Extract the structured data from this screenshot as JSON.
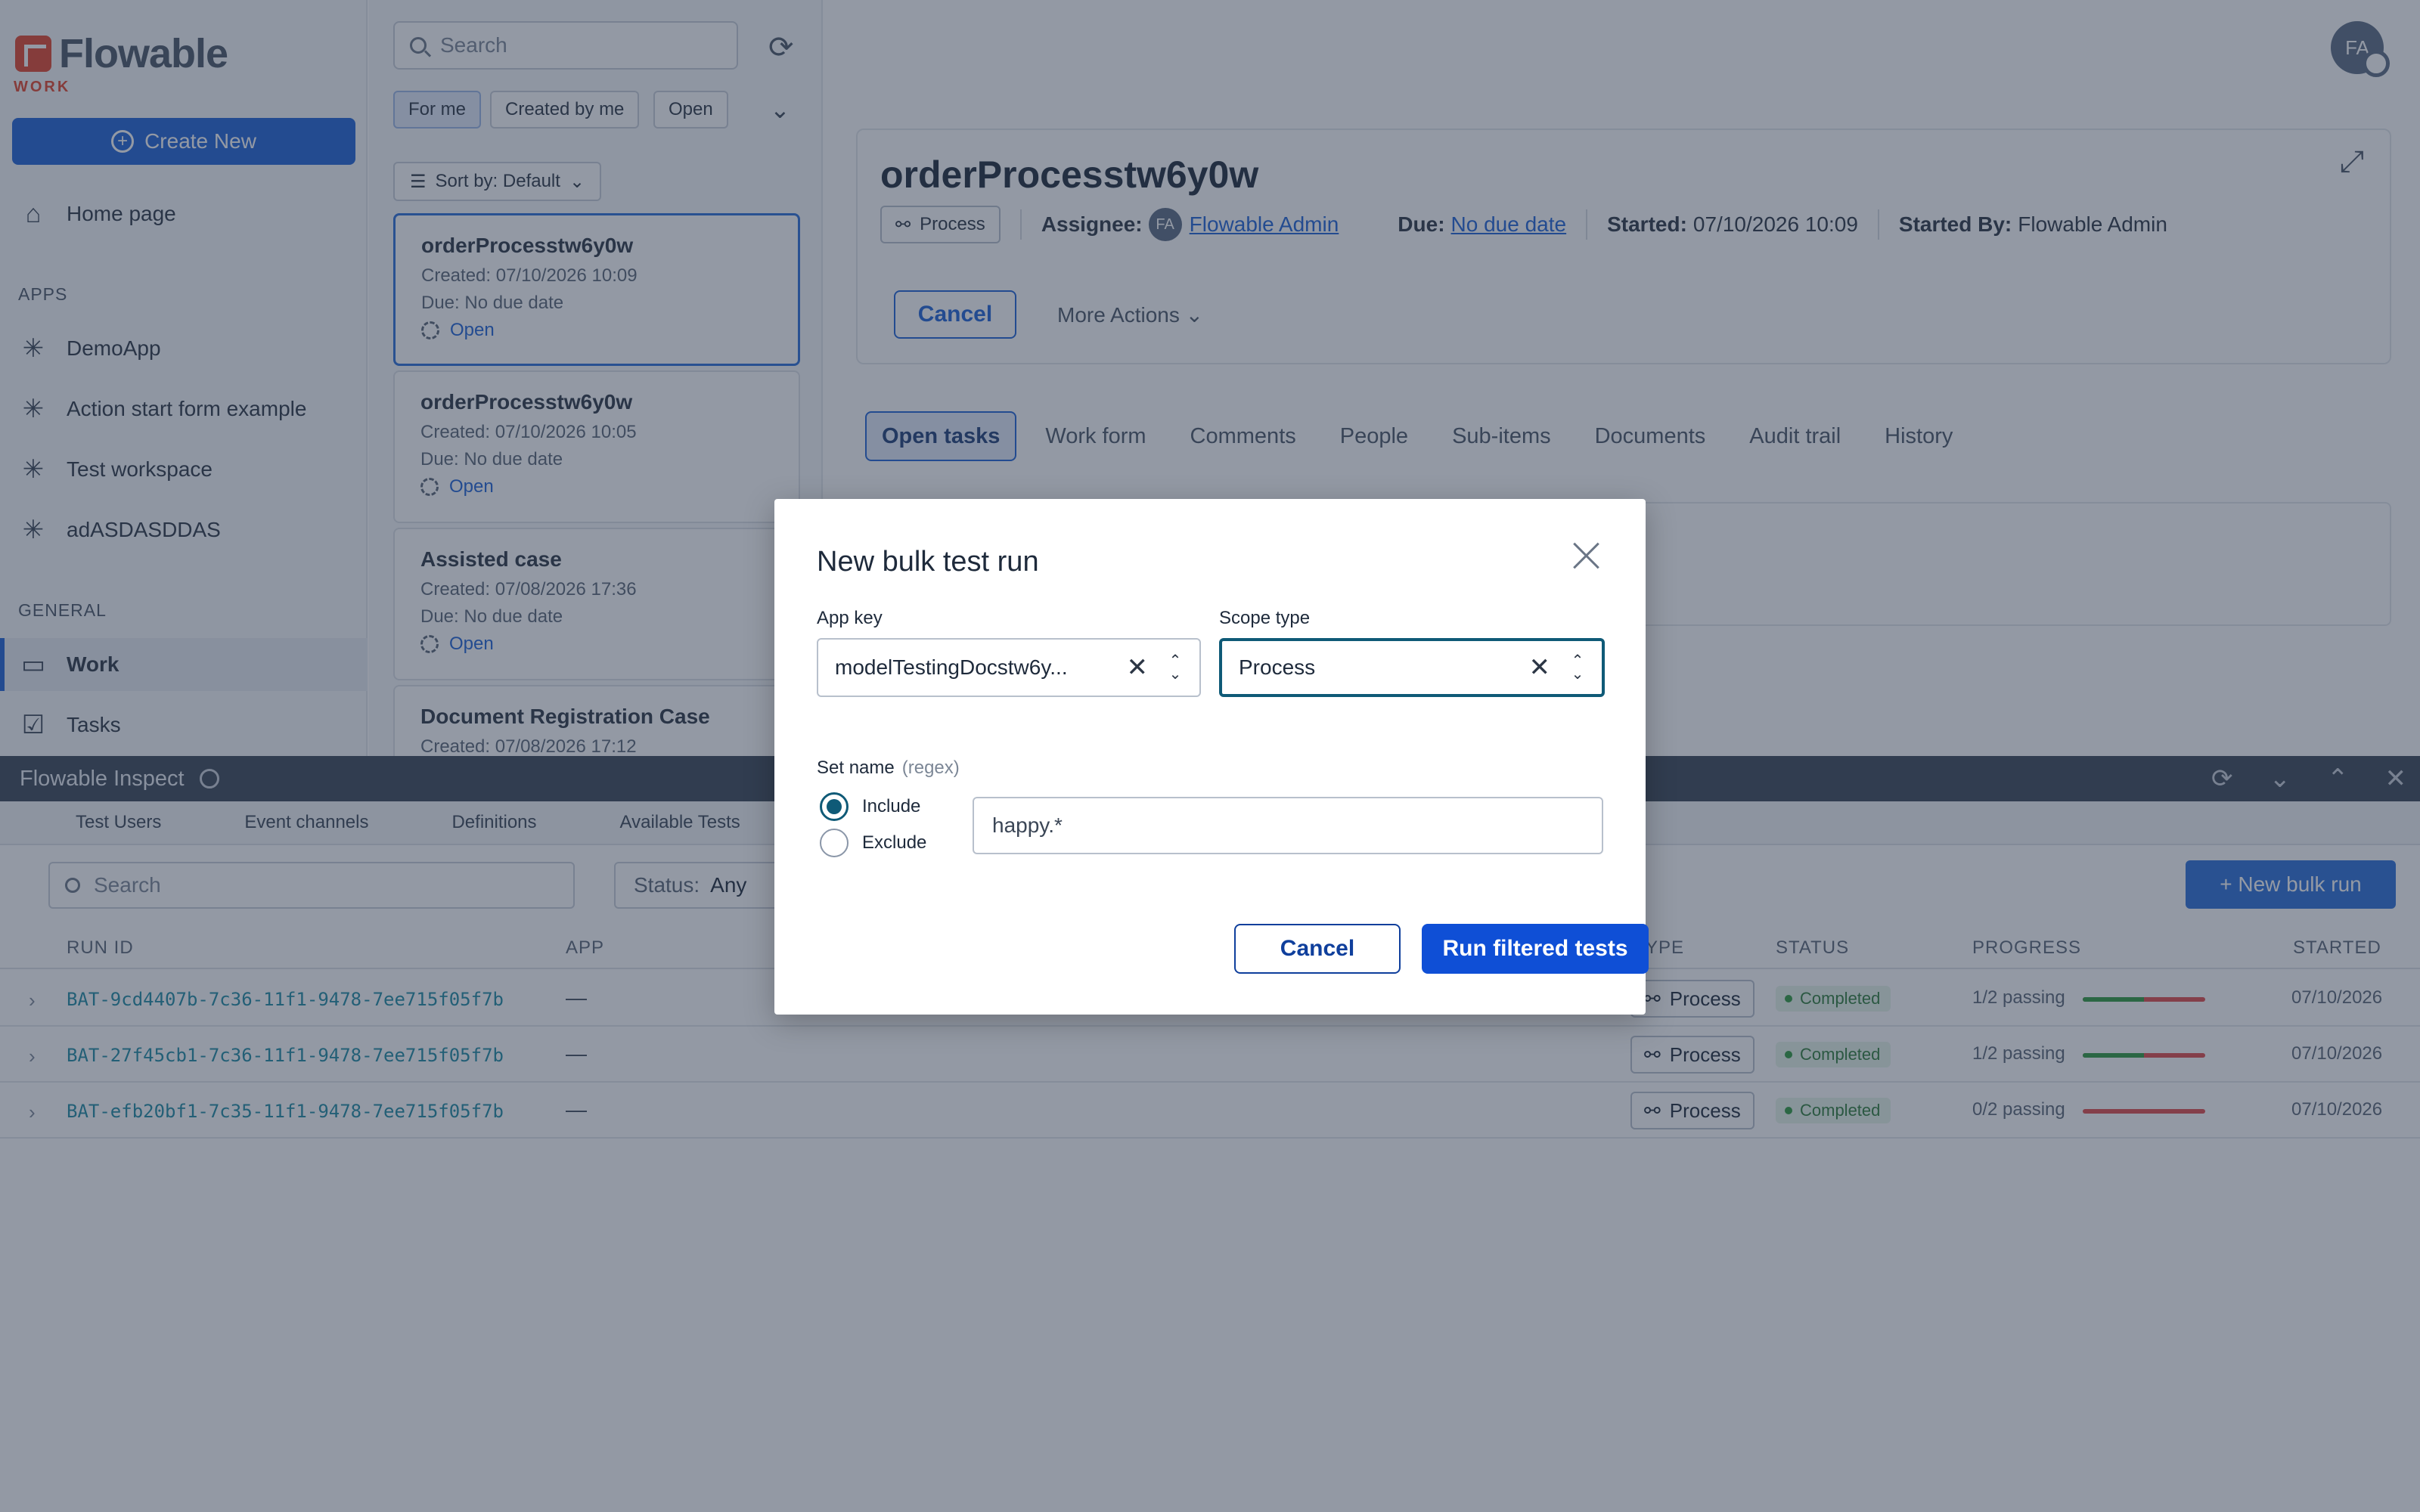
{
  "app": {
    "logo_text": "Flowable",
    "logo_sub": "WORK",
    "create_new": "Create New"
  },
  "sidebar": {
    "home": "Home page",
    "apps_heading": "APPS",
    "apps": [
      "DemoApp",
      "Action start form example",
      "Test workspace",
      "adASDASDDAS"
    ],
    "general_heading": "GENERAL",
    "general": [
      "Work",
      "Tasks"
    ]
  },
  "list": {
    "search_placeholder": "Search",
    "filters": [
      "For me",
      "Created by me",
      "Open"
    ],
    "sort_label": "Sort by: Default",
    "items": [
      {
        "title": "orderProcesstw6y0w",
        "created": "Created: 07/10/2026 10:09",
        "due": "Due: No due date",
        "status": "Open"
      },
      {
        "title": "orderProcesstw6y0w",
        "created": "Created: 07/10/2026 10:05",
        "due": "Due: No due date",
        "status": "Open"
      },
      {
        "title": "Assisted case",
        "created": "Created: 07/08/2026 17:36",
        "due": "Due: No due date",
        "status": "Open"
      },
      {
        "title": "Document Registration Case",
        "created": "Created: 07/08/2026 17:12",
        "due": "",
        "status": ""
      }
    ]
  },
  "detail": {
    "title": "orderProcesstw6y0w",
    "type_badge": "Process",
    "assignee_label": "Assignee:",
    "assignee_initials": "FA",
    "assignee_name": "Flowable Admin",
    "due_label": "Due:",
    "due_value": "No due date",
    "started_label": "Started:",
    "started_value": "07/10/2026 10:09",
    "started_by_label": "Started By:",
    "started_by_value": "Flowable Admin",
    "cancel": "Cancel",
    "more_actions": "More Actions",
    "tabs": [
      "Open tasks",
      "Work form",
      "Comments",
      "People",
      "Sub-items",
      "Documents",
      "Audit trail",
      "History"
    ]
  },
  "user": {
    "initials": "FA"
  },
  "inspect": {
    "title": "Flowable Inspect",
    "tabs": [
      "Test Users",
      "Event channels",
      "Definitions",
      "Available Tests"
    ],
    "search_placeholder": "Search",
    "status_label": "Status:",
    "status_value": "Any",
    "new_bulk_run": "+ New bulk run",
    "columns": {
      "run_id": "RUN ID",
      "app": "APP",
      "type": "YPE",
      "status": "STATUS",
      "progress": "PROGRESS",
      "started": "STARTED"
    },
    "rows": [
      {
        "run_id": "BAT-9cd4407b-7c36-11f1-9478-7ee715f05f7b",
        "app": "—",
        "type": "Process",
        "status": "Completed",
        "progress": "1/2 passing",
        "progress_fraction": 0.5,
        "started": "07/10/2026"
      },
      {
        "run_id": "BAT-27f45cb1-7c36-11f1-9478-7ee715f05f7b",
        "app": "—",
        "type": "Process",
        "status": "Completed",
        "progress": "1/2 passing",
        "progress_fraction": 0.5,
        "started": "07/10/2026"
      },
      {
        "run_id": "BAT-efb20bf1-7c35-11f1-9478-7ee715f05f7b",
        "app": "—",
        "type": "Process",
        "status": "Completed",
        "progress": "0/2 passing",
        "progress_fraction": 0,
        "started": "07/10/2026"
      }
    ]
  },
  "modal": {
    "title": "New bulk test run",
    "app_key_label": "App key",
    "app_key_value": "modelTestingDocstw6y...",
    "scope_type_label": "Scope type",
    "scope_type_value": "Process",
    "set_name_label": "Set name",
    "set_name_hint": "(regex)",
    "include_label": "Include",
    "exclude_label": "Exclude",
    "set_name_value": "happy.*",
    "cancel": "Cancel",
    "run": "Run filtered tests"
  }
}
